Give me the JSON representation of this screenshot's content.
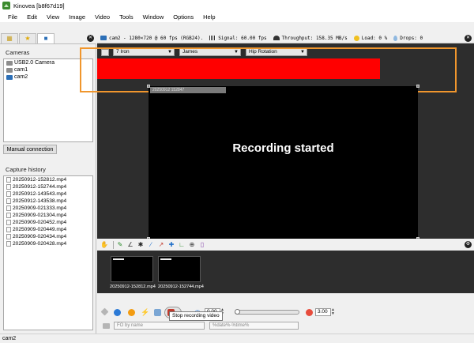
{
  "window": {
    "title": "Kinovea [b8f67d19]"
  },
  "menu": [
    "File",
    "Edit",
    "View",
    "Image",
    "Video",
    "Tools",
    "Window",
    "Options",
    "Help"
  ],
  "left_panel": {
    "cameras_label": "Cameras",
    "cameras": [
      {
        "label": "USB2.0 Camera",
        "icon": "gray-camera-icon"
      },
      {
        "label": "cam1",
        "icon": "gray-camera-icon"
      },
      {
        "label": "cam2",
        "icon": "blue-camera-icon"
      }
    ],
    "manual_connection_label": "Manual connection",
    "capture_history_label": "Capture history",
    "history": [
      "20250912-152812.mp4",
      "20250912-152744.mp4",
      "20250912-143543.mp4",
      "20250912-143538.mp4",
      "20250909-021333.mp4",
      "20250909-021304.mp4",
      "20250909-020452.mp4",
      "20250909-020449.mp4",
      "20250909-020434.mp4",
      "20250909-020428.mp4"
    ]
  },
  "infobar": {
    "camera": "cam2 - 1280×720 @ 60 fps (RGB24).",
    "signal": "Signal: 60.00 fps",
    "throughput": "Throughput: 158.35 MB/s",
    "load": "Load:   0 %",
    "drops": "Drops: 0"
  },
  "combos": {
    "club": "7 Iron",
    "player": "James",
    "metric": "Hip Rotation"
  },
  "video": {
    "overlay_text": "Recording started",
    "tag_text": "20250912 152847"
  },
  "thumbnails": [
    {
      "label": "20250912-152812.mp4"
    },
    {
      "label": "20250912-152744.mp4"
    }
  ],
  "controls": {
    "delay_value": "0.00",
    "speed_value": "3.00",
    "tooltip": "Stop recording video",
    "name_field": "FO by name",
    "pattern_field": "%date%-%time%"
  },
  "statusbar": {
    "text": "cam2"
  },
  "colors": {
    "accent_orange": "#f0962d",
    "red_bar": "#ff0000",
    "workspace": "#2d2d2d"
  }
}
